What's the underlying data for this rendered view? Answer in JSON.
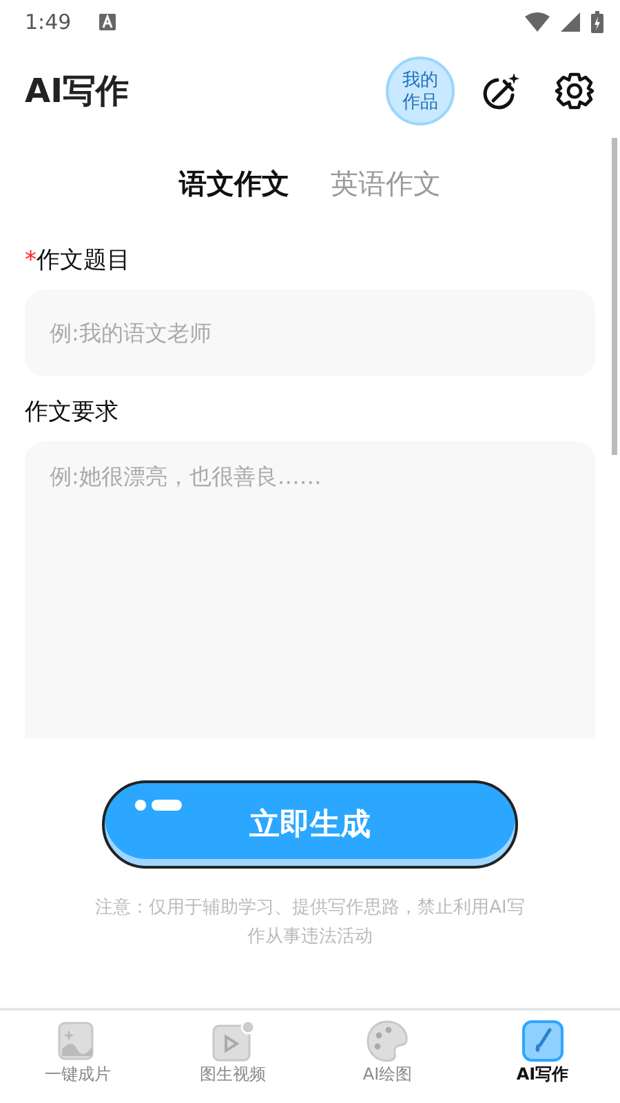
{
  "status_bar": {
    "time": "1:49"
  },
  "header": {
    "title": "AI写作",
    "works_bubble": "我的作品"
  },
  "tabs": [
    {
      "label": "语文作文",
      "selected": true
    },
    {
      "label": "英语作文",
      "selected": false
    }
  ],
  "form": [
    {
      "kind": "input",
      "label": "作文题目",
      "required_mark": "*",
      "placeholder": "例:我的语文老师"
    },
    {
      "kind": "textarea",
      "label": "作文要求",
      "placeholder": "例:她很漂亮，也很善良……"
    }
  ],
  "generate_button": "立即生成",
  "notice": "注意：仅用于辅助学习、提供写作思路，禁止利用AI写作从事违法活动",
  "bottom_nav": [
    {
      "label": "一键成片",
      "kind": "photo",
      "selected": false
    },
    {
      "label": "图生视频",
      "kind": "video",
      "selected": false
    },
    {
      "label": "AI绘图",
      "kind": "palette",
      "selected": false
    },
    {
      "label": "AI写作",
      "kind": "brush",
      "selected": true
    }
  ]
}
